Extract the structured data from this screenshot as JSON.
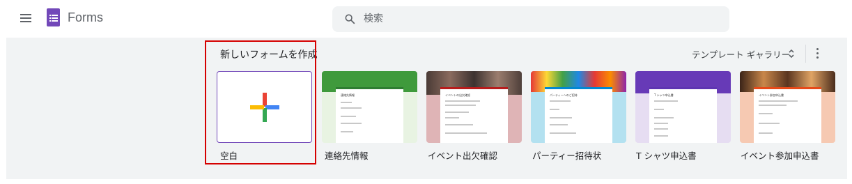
{
  "header": {
    "app_name": "Forms",
    "search_placeholder": "検索"
  },
  "section": {
    "title": "新しいフォームを作成",
    "gallery_label": "テンプレート ギャラリー"
  },
  "templates": [
    {
      "label": "空白",
      "mini_title": ""
    },
    {
      "label": "連絡先情報",
      "mini_title": "連絡先情報"
    },
    {
      "label": "イベント出欠確認",
      "mini_title": "イベントの出欠確認"
    },
    {
      "label": "パーティー招待状",
      "mini_title": "パーティーへのご招待"
    },
    {
      "label": "T シャツ申込書",
      "mini_title": "T シャツ申込書"
    },
    {
      "label": "イベント参加申込書",
      "mini_title": "イベント参加申込書"
    }
  ],
  "colors": {
    "brand": "#7248b9",
    "highlight": "#d50000",
    "plus_blue": "#4285f4",
    "plus_red": "#ea4335",
    "plus_yellow": "#fbbc04",
    "plus_green": "#34a853"
  }
}
